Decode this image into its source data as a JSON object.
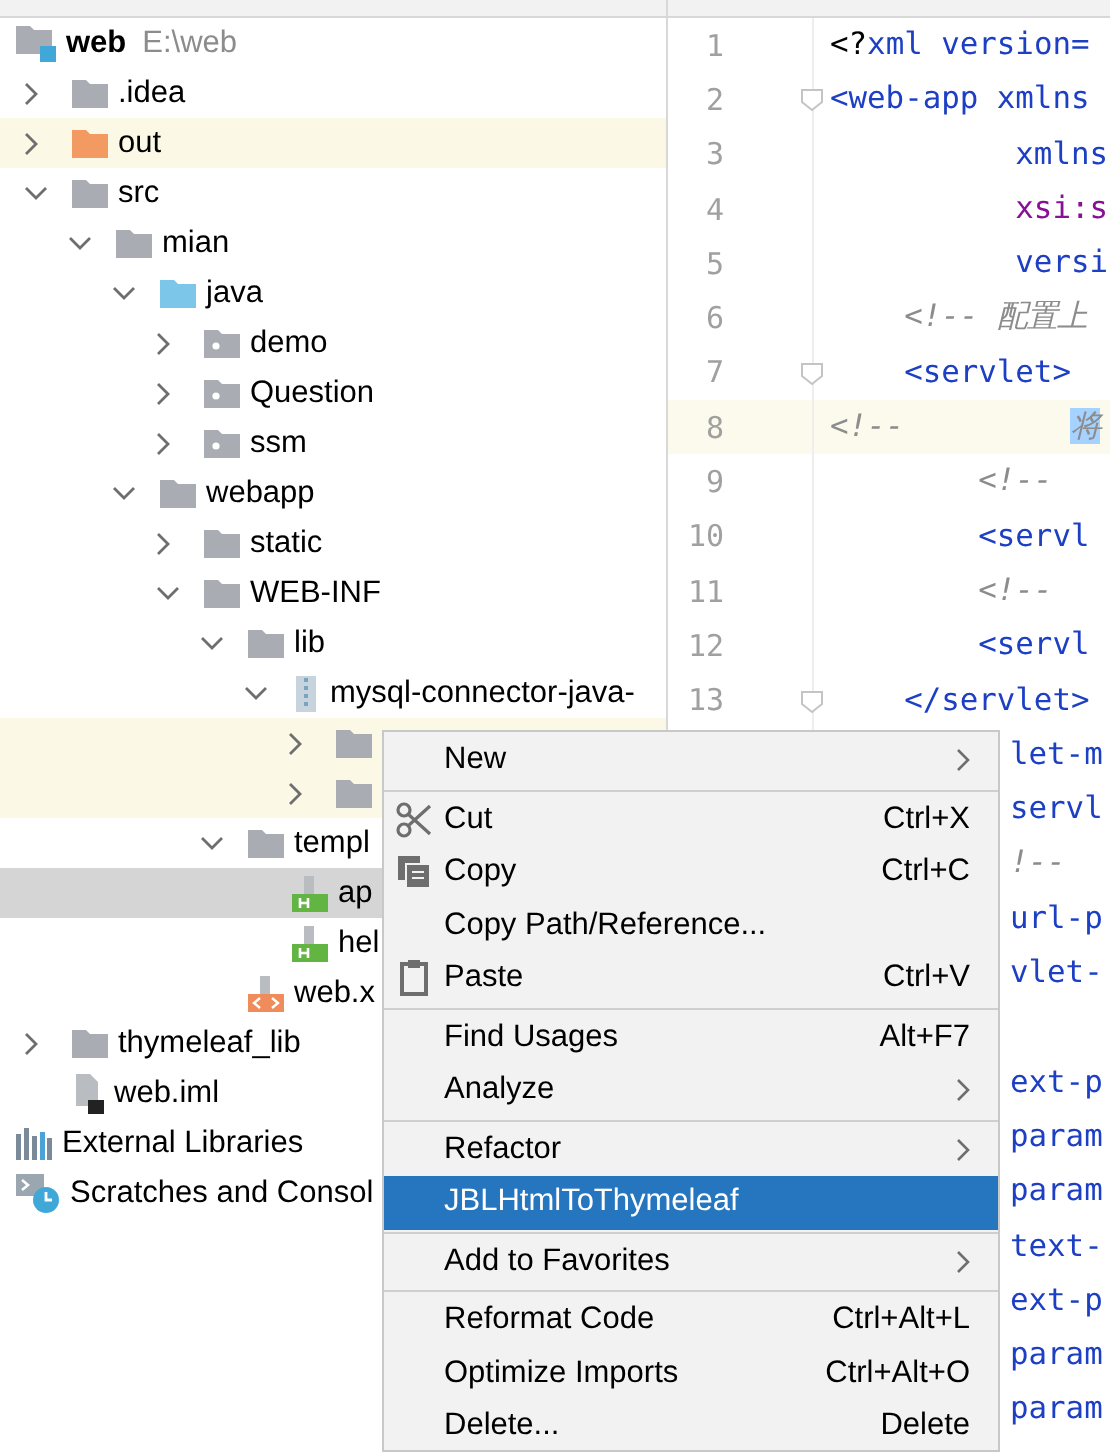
{
  "tree": [
    {
      "label": "web",
      "path": "E:\\web",
      "kind": "project",
      "selected": false,
      "highlighted": false,
      "children": [
        {
          "label": ".idea",
          "kind": "folder",
          "expanded": false,
          "selected": false,
          "highlighted": false
        },
        {
          "label": "out",
          "kind": "excluded",
          "expanded": false,
          "selected": false,
          "highlighted": true
        },
        {
          "label": "src",
          "kind": "folder",
          "expanded": true,
          "selected": false,
          "highlighted": false,
          "children": [
            {
              "label": "mian",
              "kind": "folder",
              "expanded": true,
              "selected": false,
              "highlighted": false,
              "children": [
                {
                  "label": "java",
                  "kind": "source",
                  "expanded": true,
                  "selected": false,
                  "highlighted": false,
                  "children": [
                    {
                      "label": "demo",
                      "kind": "package",
                      "expanded": false,
                      "selected": false,
                      "highlighted": false
                    },
                    {
                      "label": "Question",
                      "kind": "package",
                      "expanded": false,
                      "selected": false,
                      "highlighted": false
                    },
                    {
                      "label": "ssm",
                      "kind": "package",
                      "expanded": false,
                      "selected": false,
                      "highlighted": false
                    }
                  ]
                },
                {
                  "label": "webapp",
                  "kind": "folder",
                  "expanded": true,
                  "selected": false,
                  "highlighted": false,
                  "children": [
                    {
                      "label": "static",
                      "kind": "folder",
                      "expanded": false,
                      "selected": false,
                      "highlighted": false
                    },
                    {
                      "label": "WEB-INF",
                      "kind": "folder",
                      "expanded": true,
                      "selected": false,
                      "highlighted": false,
                      "children": [
                        {
                          "label": "lib",
                          "kind": "folder",
                          "expanded": true,
                          "selected": false,
                          "highlighted": false,
                          "children": [
                            {
                              "label": "mysql-connector-java-",
                              "kind": "jar",
                              "expanded": true,
                              "selected": false,
                              "highlighted": false,
                              "children": [
                                {
                                  "kind": "folder",
                                  "expanded": false,
                                  "selected": false,
                                  "highlighted": true
                                },
                                {
                                  "kind": "folder",
                                  "expanded": false,
                                  "selected": false,
                                  "highlighted": true
                                }
                              ]
                            }
                          ]
                        },
                        {
                          "label": "templ",
                          "kind": "folder",
                          "expanded": true,
                          "selected": false,
                          "highlighted": false,
                          "children": [
                            {
                              "label": "ap",
                              "kind": "html",
                              "selected": true,
                              "highlighted": false
                            },
                            {
                              "label": "hel",
                              "kind": "html",
                              "selected": false,
                              "highlighted": false
                            }
                          ]
                        },
                        {
                          "label": "web.x",
                          "kind": "xml",
                          "selected": false,
                          "highlighted": false
                        }
                      ]
                    }
                  ]
                }
              ]
            }
          ]
        },
        {
          "label": "thymeleaf_lib",
          "kind": "folder",
          "expanded": false,
          "selected": false,
          "highlighted": false
        },
        {
          "label": "web.iml",
          "kind": "iml",
          "selected": false,
          "highlighted": false
        }
      ]
    },
    {
      "label": "External Libraries",
      "kind": "libraries",
      "selected": false,
      "highlighted": false
    },
    {
      "label": "Scratches and Consol",
      "kind": "scratches",
      "selected": false,
      "highlighted": false
    }
  ],
  "editor": {
    "lines": [
      {
        "number": "1",
        "highlighted": false,
        "tokens": [
          {
            "text": "<?",
            "kind": "plain"
          },
          {
            "text": "xml version=",
            "kind": "tag"
          }
        ]
      },
      {
        "number": "2",
        "highlighted": false,
        "fold": true,
        "tokens": [
          {
            "text": "<web-app xmlns",
            "kind": "tag"
          }
        ]
      },
      {
        "number": "3",
        "highlighted": false,
        "tokens": [
          {
            "text": "          xmlns",
            "kind": "attr"
          }
        ]
      },
      {
        "number": "4",
        "highlighted": false,
        "tokens": [
          {
            "text": "          xsi:s",
            "kind": "ns"
          }
        ]
      },
      {
        "number": "5",
        "highlighted": false,
        "tokens": [
          {
            "text": "          versi",
            "kind": "attr"
          }
        ]
      },
      {
        "number": "6",
        "highlighted": false,
        "tokens": [
          {
            "text": "    <!-- 配置上",
            "kind": "comment"
          }
        ]
      },
      {
        "number": "7",
        "highlighted": false,
        "fold": true,
        "tokens": [
          {
            "text": "    <servlet>",
            "kind": "tag"
          }
        ]
      },
      {
        "number": "8",
        "highlighted": true,
        "tokens": [
          {
            "text": "<!--         ",
            "kind": "comment"
          },
          {
            "text": "将",
            "kind": "selection"
          }
        ]
      },
      {
        "number": "9",
        "highlighted": false,
        "tokens": [
          {
            "text": "        <!--",
            "kind": "comment"
          }
        ]
      },
      {
        "number": "10",
        "highlighted": false,
        "tokens": [
          {
            "text": "        <servl",
            "kind": "tag"
          }
        ]
      },
      {
        "number": "11",
        "highlighted": false,
        "tokens": [
          {
            "text": "        <!--",
            "kind": "comment"
          }
        ]
      },
      {
        "number": "12",
        "highlighted": false,
        "tokens": [
          {
            "text": "        <servl",
            "kind": "tag"
          }
        ]
      },
      {
        "number": "13",
        "highlighted": false,
        "fold": true,
        "tokens": [
          {
            "text": "    </servlet>",
            "kind": "tag"
          }
        ]
      }
    ],
    "hidden_lines": [
      {
        "kind": "code",
        "tokens": [
          {
            "text": "let-m",
            "kind": "tag"
          }
        ]
      },
      {
        "kind": "code",
        "tokens": [
          {
            "text": "servl",
            "kind": "tag"
          }
        ]
      },
      {
        "kind": "code",
        "tokens": [
          {
            "text": "!--",
            "kind": "comment"
          }
        ]
      },
      {
        "kind": "code",
        "tokens": [
          {
            "text": "url-p",
            "kind": "tag"
          }
        ]
      },
      {
        "kind": "code",
        "tokens": [
          {
            "text": "vlet-",
            "kind": "tag"
          }
        ]
      },
      {
        "kind": "blank"
      },
      {
        "kind": "code",
        "tokens": [
          {
            "text": "ext-p",
            "kind": "tag"
          }
        ]
      },
      {
        "kind": "code",
        "tokens": [
          {
            "text": "param",
            "kind": "tag"
          }
        ]
      },
      {
        "kind": "code",
        "tokens": [
          {
            "text": "param",
            "kind": "tag"
          }
        ]
      },
      {
        "kind": "code",
        "tokens": [
          {
            "text": "text-",
            "kind": "tag"
          }
        ]
      },
      {
        "kind": "code",
        "tokens": [
          {
            "text": "ext-p",
            "kind": "tag"
          }
        ]
      },
      {
        "kind": "code",
        "tokens": [
          {
            "text": "param",
            "kind": "tag"
          }
        ]
      },
      {
        "kind": "code",
        "tokens": [
          {
            "text": "param",
            "kind": "tag"
          }
        ]
      }
    ]
  },
  "context_menu": [
    [
      {
        "label": "New",
        "submenu": true,
        "selected": false
      }
    ],
    [
      {
        "label": "Cut",
        "shortcut": "Ctrl+X",
        "kind": "cut",
        "selected": false
      },
      {
        "label": "Copy",
        "shortcut": "Ctrl+C",
        "kind": "copy",
        "selected": false
      },
      {
        "label": "Copy Path/Reference...",
        "selected": false
      },
      {
        "label": "Paste",
        "shortcut": "Ctrl+V",
        "kind": "paste",
        "selected": false
      }
    ],
    [
      {
        "label": "Find Usages",
        "shortcut": "Alt+F7",
        "selected": false
      },
      {
        "label": "Analyze",
        "submenu": true,
        "selected": false
      }
    ],
    [
      {
        "label": "Refactor",
        "submenu": true,
        "selected": false
      },
      {
        "label": "JBLHtmlToThymeleaf",
        "selected": true
      }
    ],
    [
      {
        "label": "Add to Favorites",
        "submenu": true,
        "selected": false
      }
    ],
    [
      {
        "label": "Reformat Code",
        "shortcut": "Ctrl+Alt+L",
        "selected": false
      },
      {
        "label": "Optimize Imports",
        "shortcut": "Ctrl+Alt+O",
        "selected": false
      },
      {
        "label": "Delete...",
        "shortcut": "Delete",
        "selected": false
      }
    ]
  ]
}
